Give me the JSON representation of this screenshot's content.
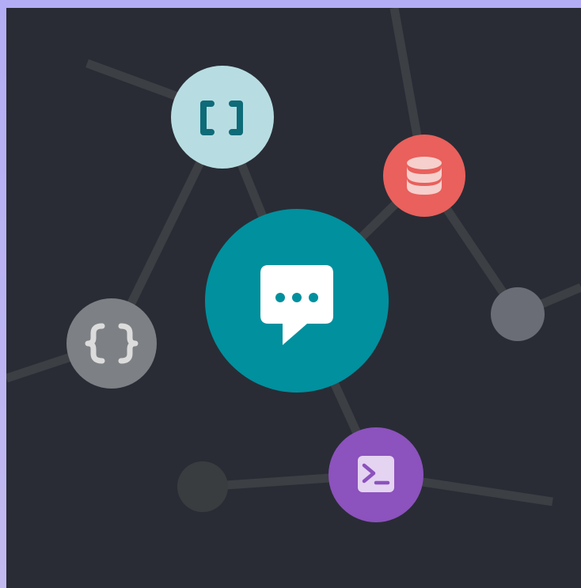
{
  "diagram": {
    "nodes": [
      {
        "id": "chat",
        "icon": "chat-bubble-icon",
        "color": "#00909e",
        "role": "hub"
      },
      {
        "id": "array",
        "icon": "square-brackets-icon",
        "color": "#b7dde2"
      },
      {
        "id": "database",
        "icon": "database-icon",
        "color": "#e9605c"
      },
      {
        "id": "object",
        "icon": "curly-braces-icon",
        "color": "#7d8084"
      },
      {
        "id": "terminal",
        "icon": "terminal-icon",
        "color": "#8c52bd"
      },
      {
        "id": "node-gray",
        "icon": "",
        "color": "#6b6d76"
      },
      {
        "id": "node-dark",
        "icon": "",
        "color": "#3a3d40"
      }
    ],
    "edges": [
      [
        "array",
        "chat"
      ],
      [
        "array",
        "object"
      ],
      [
        "chat",
        "database"
      ],
      [
        "chat",
        "terminal"
      ],
      [
        "database",
        "node-gray"
      ],
      [
        "node-dark",
        "terminal"
      ]
    ],
    "colors": {
      "background": "#292c35",
      "frame": "#b3adf5",
      "edge": "#3c3f43"
    }
  }
}
